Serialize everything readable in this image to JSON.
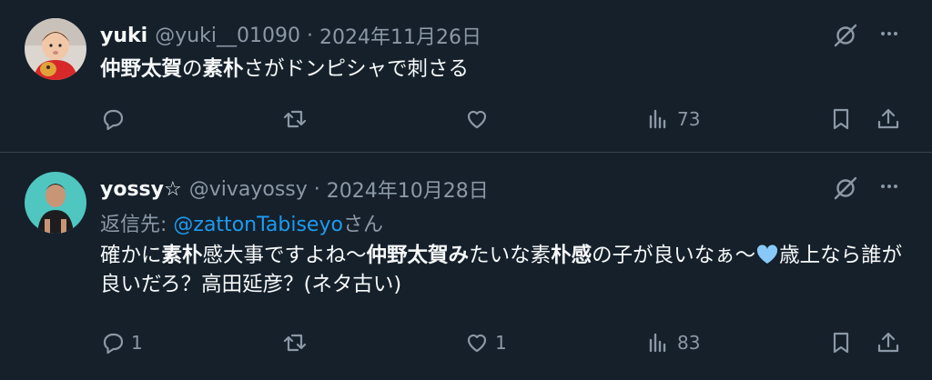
{
  "tweets": [
    {
      "name": "yuki",
      "handle": "@yuki__01090",
      "separator": "·",
      "date": "2024年11月26日",
      "text_parts": [
        {
          "t": "仲野太賀",
          "bold": true
        },
        {
          "t": "の",
          "bold": false
        },
        {
          "t": "素朴",
          "bold": true
        },
        {
          "t": "さがドンピシャで刺さる",
          "bold": false
        }
      ],
      "reply_count": "",
      "retweet_count": "",
      "like_count": "",
      "view_count": "73"
    },
    {
      "name": "yossy☆",
      "handle": "@vivayossy",
      "separator": "·",
      "date": "2024年10月28日",
      "reply_to_prefix": "返信先: ",
      "reply_to_mention": "@zattonTabiseyo",
      "reply_to_suffix": "さん",
      "text_parts": [
        {
          "t": "確かに",
          "bold": false
        },
        {
          "t": "素朴",
          "bold": true
        },
        {
          "t": "感大事ですよね〜",
          "bold": false
        },
        {
          "t": "仲野太賀み",
          "bold": true
        },
        {
          "t": "たいな素",
          "bold": false
        },
        {
          "t": "朴感",
          "bold": true
        },
        {
          "t": "の子が良いなぁ〜",
          "bold": false
        },
        {
          "t": "歳上なら誰が良いだろ？高田延彦？(ネタ古い)",
          "bold": false
        }
      ],
      "reply_count": "1",
      "retweet_count": "",
      "like_count": "1",
      "view_count": "83"
    }
  ],
  "icons": {
    "reply": "reply-icon",
    "retweet": "retweet-icon",
    "like": "heart-icon",
    "views": "views-icon",
    "bookmark": "bookmark-icon",
    "share": "share-icon",
    "grok": "grok-icon",
    "more": "more-icon"
  },
  "colors": {
    "background": "#15202b",
    "text": "#f7f9f9",
    "muted": "#8b98a5",
    "link": "#1d9bf0",
    "divider": "#38444d",
    "heart_emoji": "#88c9f9"
  }
}
